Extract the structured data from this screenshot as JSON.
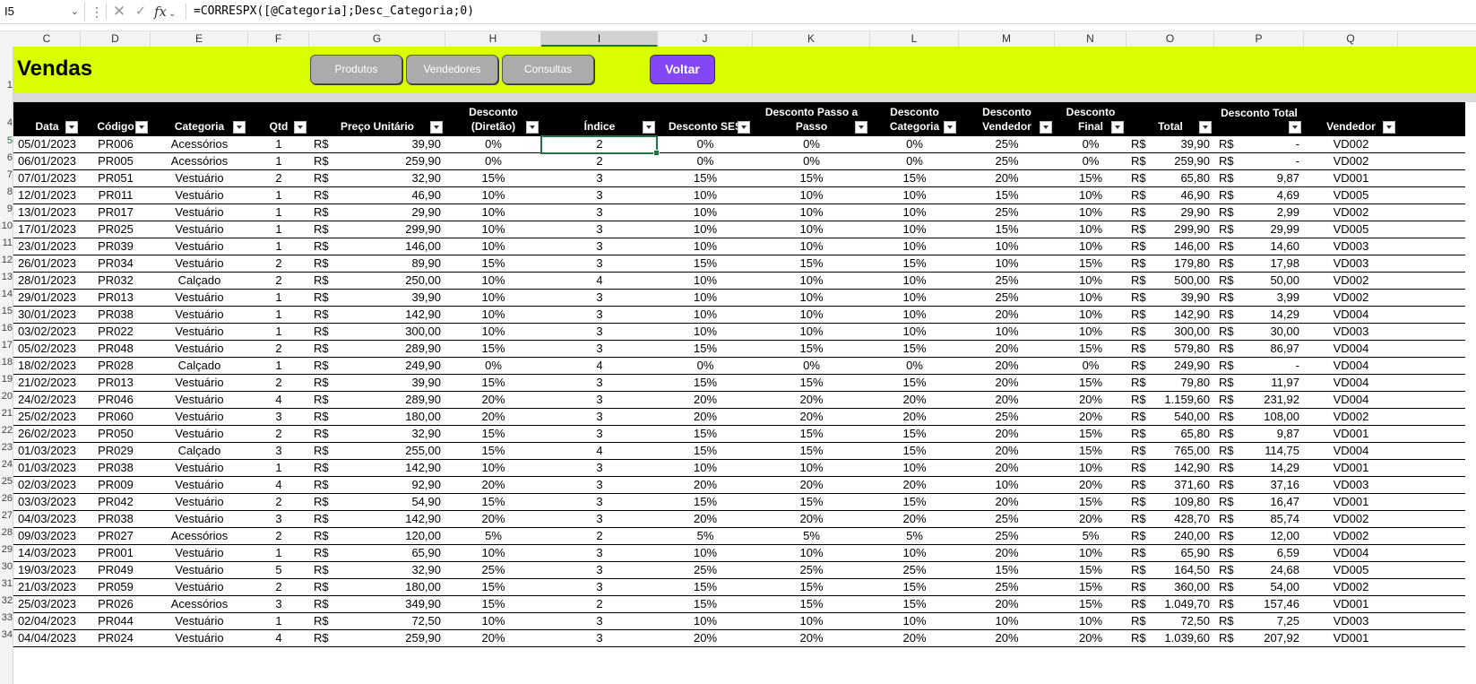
{
  "formula_bar": {
    "name_box": "I5",
    "kebab": "⋮",
    "cancel": "✕",
    "enter": "✓",
    "fx": "fx",
    "formula": "=CORRESPX([@Categoria];Desc_Categoria;0)"
  },
  "columns": [
    "C",
    "D",
    "E",
    "F",
    "G",
    "H",
    "I",
    "J",
    "K",
    "L",
    "M",
    "N",
    "O",
    "P",
    "Q"
  ],
  "selected_column": "I",
  "row_numbers": [
    "1",
    "4",
    "5",
    "6",
    "7",
    "8",
    "9",
    "10",
    "11",
    "12",
    "13",
    "14",
    "15",
    "16",
    "17",
    "18",
    "19",
    "20",
    "21",
    "22",
    "23",
    "24",
    "25",
    "26",
    "27",
    "28",
    "29",
    "30",
    "31",
    "32",
    "33",
    "34"
  ],
  "banner": {
    "title": "Vendas",
    "buttons": {
      "produtos": "Produtos",
      "vendedores": "Vendedores",
      "consultas": "Consultas",
      "voltar": "Voltar"
    },
    "accent": "#d9ff00",
    "button_accent": "#8347f6"
  },
  "table": {
    "headers": {
      "data": "Data",
      "codigo": "Código",
      "categoria": "Categoria",
      "qtd": "Qtd",
      "preco": "Preço Unitário",
      "desc_diretao": "Desconto\n(Diretão)",
      "indice": "Índice",
      "desc_ses": "Desconto SES",
      "desc_passo": "Desconto Passo a\nPasso",
      "desc_categoria": "Desconto\nCategoria",
      "desc_vendedor": "Desconto\nVendedor",
      "desc_final": "Desconto\nFinal",
      "total": "Total",
      "desc_total": "Desconto Total",
      "vendedor": "Vendedor"
    },
    "currency": "R$",
    "rows": [
      [
        "05/01/2023",
        "PR006",
        "Acessórios",
        "1",
        "39,90",
        "0%",
        "2",
        "0%",
        "0%",
        "0%",
        "25%",
        "0%",
        "39,90",
        "-",
        "VD002"
      ],
      [
        "06/01/2023",
        "PR005",
        "Acessórios",
        "1",
        "259,90",
        "0%",
        "2",
        "0%",
        "0%",
        "0%",
        "25%",
        "0%",
        "259,90",
        "-",
        "VD002"
      ],
      [
        "07/01/2023",
        "PR051",
        "Vestuário",
        "2",
        "32,90",
        "15%",
        "3",
        "15%",
        "15%",
        "15%",
        "20%",
        "15%",
        "65,80",
        "9,87",
        "VD001"
      ],
      [
        "12/01/2023",
        "PR011",
        "Vestuário",
        "1",
        "46,90",
        "10%",
        "3",
        "10%",
        "10%",
        "10%",
        "15%",
        "10%",
        "46,90",
        "4,69",
        "VD005"
      ],
      [
        "13/01/2023",
        "PR017",
        "Vestuário",
        "1",
        "29,90",
        "10%",
        "3",
        "10%",
        "10%",
        "10%",
        "25%",
        "10%",
        "29,90",
        "2,99",
        "VD002"
      ],
      [
        "17/01/2023",
        "PR025",
        "Vestuário",
        "1",
        "299,90",
        "10%",
        "3",
        "10%",
        "10%",
        "10%",
        "15%",
        "10%",
        "299,90",
        "29,99",
        "VD005"
      ],
      [
        "23/01/2023",
        "PR039",
        "Vestuário",
        "1",
        "146,00",
        "10%",
        "3",
        "10%",
        "10%",
        "10%",
        "10%",
        "10%",
        "146,00",
        "14,60",
        "VD003"
      ],
      [
        "26/01/2023",
        "PR034",
        "Vestuário",
        "2",
        "89,90",
        "15%",
        "3",
        "15%",
        "15%",
        "15%",
        "10%",
        "15%",
        "179,80",
        "17,98",
        "VD003"
      ],
      [
        "28/01/2023",
        "PR032",
        "Calçado",
        "2",
        "250,00",
        "10%",
        "4",
        "10%",
        "10%",
        "10%",
        "25%",
        "10%",
        "500,00",
        "50,00",
        "VD002"
      ],
      [
        "29/01/2023",
        "PR013",
        "Vestuário",
        "1",
        "39,90",
        "10%",
        "3",
        "10%",
        "10%",
        "10%",
        "25%",
        "10%",
        "39,90",
        "3,99",
        "VD002"
      ],
      [
        "30/01/2023",
        "PR038",
        "Vestuário",
        "1",
        "142,90",
        "10%",
        "3",
        "10%",
        "10%",
        "10%",
        "20%",
        "10%",
        "142,90",
        "14,29",
        "VD004"
      ],
      [
        "03/02/2023",
        "PR022",
        "Vestuário",
        "1",
        "300,00",
        "10%",
        "3",
        "10%",
        "10%",
        "10%",
        "10%",
        "10%",
        "300,00",
        "30,00",
        "VD003"
      ],
      [
        "05/02/2023",
        "PR048",
        "Vestuário",
        "2",
        "289,90",
        "15%",
        "3",
        "15%",
        "15%",
        "15%",
        "20%",
        "15%",
        "579,80",
        "86,97",
        "VD004"
      ],
      [
        "18/02/2023",
        "PR028",
        "Calçado",
        "1",
        "249,90",
        "0%",
        "4",
        "0%",
        "0%",
        "0%",
        "20%",
        "0%",
        "249,90",
        "-",
        "VD004"
      ],
      [
        "21/02/2023",
        "PR013",
        "Vestuário",
        "2",
        "39,90",
        "15%",
        "3",
        "15%",
        "15%",
        "15%",
        "20%",
        "15%",
        "79,80",
        "11,97",
        "VD004"
      ],
      [
        "24/02/2023",
        "PR046",
        "Vestuário",
        "4",
        "289,90",
        "20%",
        "3",
        "20%",
        "20%",
        "20%",
        "20%",
        "20%",
        "1.159,60",
        "231,92",
        "VD004"
      ],
      [
        "25/02/2023",
        "PR060",
        "Vestuário",
        "3",
        "180,00",
        "20%",
        "3",
        "20%",
        "20%",
        "20%",
        "25%",
        "20%",
        "540,00",
        "108,00",
        "VD002"
      ],
      [
        "26/02/2023",
        "PR050",
        "Vestuário",
        "2",
        "32,90",
        "15%",
        "3",
        "15%",
        "15%",
        "15%",
        "20%",
        "15%",
        "65,80",
        "9,87",
        "VD001"
      ],
      [
        "01/03/2023",
        "PR029",
        "Calçado",
        "3",
        "255,00",
        "15%",
        "4",
        "15%",
        "15%",
        "15%",
        "20%",
        "15%",
        "765,00",
        "114,75",
        "VD004"
      ],
      [
        "01/03/2023",
        "PR038",
        "Vestuário",
        "1",
        "142,90",
        "10%",
        "3",
        "10%",
        "10%",
        "10%",
        "20%",
        "10%",
        "142,90",
        "14,29",
        "VD001"
      ],
      [
        "02/03/2023",
        "PR009",
        "Vestuário",
        "4",
        "92,90",
        "20%",
        "3",
        "20%",
        "20%",
        "20%",
        "10%",
        "20%",
        "371,60",
        "37,16",
        "VD003"
      ],
      [
        "03/03/2023",
        "PR042",
        "Vestuário",
        "2",
        "54,90",
        "15%",
        "3",
        "15%",
        "15%",
        "15%",
        "20%",
        "15%",
        "109,80",
        "16,47",
        "VD001"
      ],
      [
        "04/03/2023",
        "PR038",
        "Vestuário",
        "3",
        "142,90",
        "20%",
        "3",
        "20%",
        "20%",
        "20%",
        "25%",
        "20%",
        "428,70",
        "85,74",
        "VD002"
      ],
      [
        "09/03/2023",
        "PR027",
        "Acessórios",
        "2",
        "120,00",
        "5%",
        "2",
        "5%",
        "5%",
        "5%",
        "25%",
        "5%",
        "240,00",
        "12,00",
        "VD002"
      ],
      [
        "14/03/2023",
        "PR001",
        "Vestuário",
        "1",
        "65,90",
        "10%",
        "3",
        "10%",
        "10%",
        "10%",
        "20%",
        "10%",
        "65,90",
        "6,59",
        "VD004"
      ],
      [
        "19/03/2023",
        "PR049",
        "Vestuário",
        "5",
        "32,90",
        "25%",
        "3",
        "25%",
        "25%",
        "25%",
        "15%",
        "15%",
        "164,50",
        "24,68",
        "VD005"
      ],
      [
        "21/03/2023",
        "PR059",
        "Vestuário",
        "2",
        "180,00",
        "15%",
        "3",
        "15%",
        "15%",
        "15%",
        "25%",
        "15%",
        "360,00",
        "54,00",
        "VD002"
      ],
      [
        "25/03/2023",
        "PR026",
        "Acessórios",
        "3",
        "349,90",
        "15%",
        "2",
        "15%",
        "15%",
        "15%",
        "20%",
        "15%",
        "1.049,70",
        "157,46",
        "VD001"
      ],
      [
        "02/04/2023",
        "PR044",
        "Vestuário",
        "1",
        "72,50",
        "10%",
        "3",
        "10%",
        "10%",
        "10%",
        "10%",
        "10%",
        "72,50",
        "7,25",
        "VD003"
      ],
      [
        "04/04/2023",
        "PR024",
        "Vestuário",
        "4",
        "259,90",
        "20%",
        "3",
        "20%",
        "20%",
        "20%",
        "20%",
        "20%",
        "1.039,60",
        "207,92",
        "VD001"
      ]
    ]
  }
}
